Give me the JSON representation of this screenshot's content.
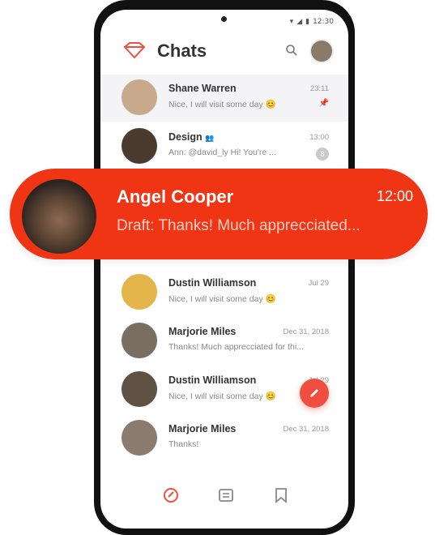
{
  "status_bar": {
    "time": "12:30"
  },
  "header": {
    "title": "Chats"
  },
  "chats": [
    {
      "name": "Shane Warren",
      "message": "Nice, I will visit some day 😊",
      "time": "23:11",
      "meta": "✓✓",
      "pinned": true
    },
    {
      "name": "Design",
      "name_suffix": "👥",
      "message": "Ann: @david_ly Hi! You're ...",
      "time": "13:00",
      "unread": "8"
    },
    {
      "name": "Dustin Williamson",
      "message": "Nice, I will visit some day 😊",
      "time": "Jul 29"
    },
    {
      "name": "Marjorie Miles",
      "message": "Thanks! Much apprecciated for thi...",
      "time": "Dec 31, 2018"
    },
    {
      "name": "Dustin Williamson",
      "message": "Nice, I will visit some day 😊",
      "time": "Jul 29"
    },
    {
      "name": "Marjorie Miles",
      "message": "Thanks!",
      "time": "Dec 31, 2018"
    }
  ],
  "highlight": {
    "name": "Angel Cooper",
    "time": "12:00",
    "draft": "Draft: Thanks! Much apprecciated..."
  },
  "colors": {
    "accent": "#f03515",
    "fab": "#f04e3e"
  },
  "icons": [
    "logo-icon",
    "search-icon",
    "pin-icon",
    "edit-icon",
    "chats-nav-icon",
    "contacts-nav-icon",
    "bookmark-nav-icon"
  ]
}
